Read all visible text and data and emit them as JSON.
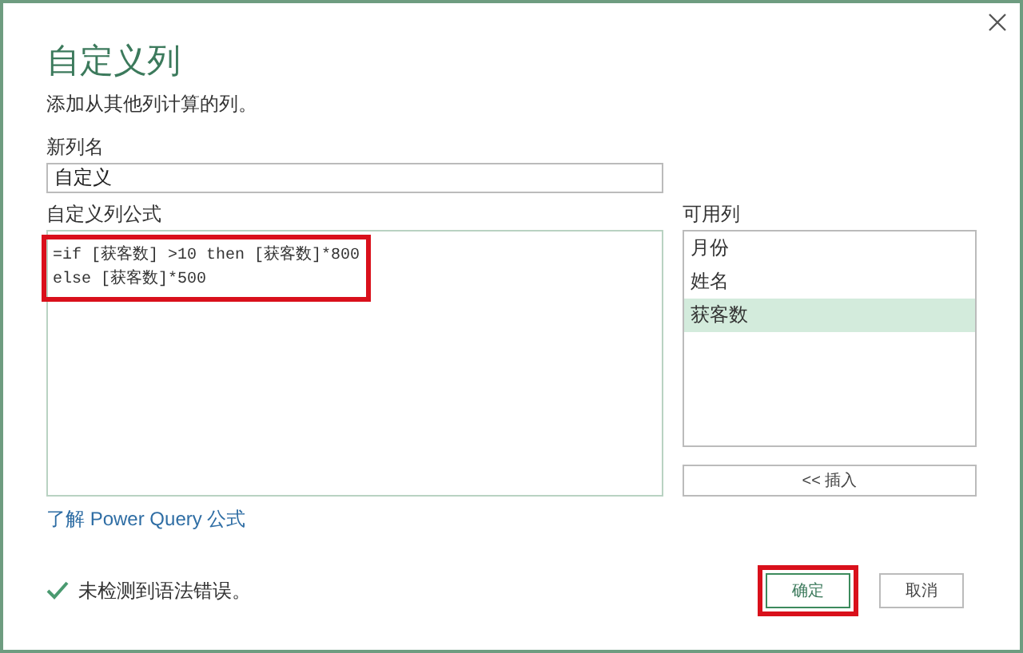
{
  "dialog": {
    "title": "自定义列",
    "subtitle": "添加从其他列计算的列。"
  },
  "new_column": {
    "label": "新列名",
    "value": "自定义"
  },
  "formula": {
    "label": "自定义列公式",
    "lines": [
      "=if [获客数] >10 then [获客数]*800",
      "else [获客数]*500"
    ],
    "highlighted": true
  },
  "available_columns": {
    "label": "可用列",
    "items": [
      {
        "label": "月份",
        "selected": false
      },
      {
        "label": "姓名",
        "selected": false
      },
      {
        "label": "获客数",
        "selected": true
      }
    ],
    "insert_button": "<< 插入"
  },
  "learn_link": "了解 Power Query 公式",
  "status": {
    "ok": true,
    "text": "未检测到语法错误。"
  },
  "buttons": [
    {
      "label": "确定",
      "kind": "primary",
      "highlighted": true
    },
    {
      "label": "取消",
      "kind": "secondary",
      "highlighted": false
    }
  ]
}
